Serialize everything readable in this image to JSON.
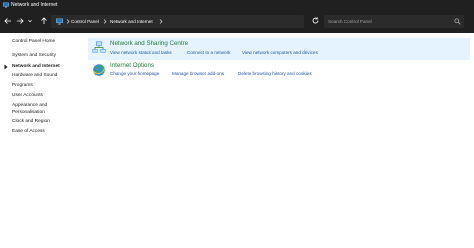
{
  "window": {
    "title": "Network and Internet"
  },
  "address_bar": {
    "breadcrumbs": [
      "Control Panel",
      "Network and Internet"
    ],
    "search_placeholder": "Search Control Panel"
  },
  "sidebar": {
    "items": [
      {
        "label": "Control Panel Home",
        "active": false
      },
      {
        "label": "System and Security",
        "active": false
      },
      {
        "label": "Network and Internet",
        "active": true
      },
      {
        "label": "Hardware and Sound",
        "active": false
      },
      {
        "label": "Programs",
        "active": false
      },
      {
        "label": "User Accounts",
        "active": false
      },
      {
        "label": "Appearance and Personalisation",
        "active": false
      },
      {
        "label": "Clock and Region",
        "active": false
      },
      {
        "label": "Ease of Access",
        "active": false
      }
    ]
  },
  "categories": [
    {
      "title": "Network and Sharing Centre",
      "icon": "network-sharing-icon",
      "links": [
        "View network status and tasks",
        "Connect to a network",
        "View network computers and devices"
      ]
    },
    {
      "title": "Internet Options",
      "icon": "internet-options-icon",
      "links": [
        "Change your homepage",
        "Manage browser add-ons",
        "Delete browsing history and cookies"
      ]
    }
  ],
  "colors": {
    "chrome_background": "#202020",
    "category_title": "#1e7d3a",
    "task_link": "#1a56a8",
    "selected_row": "#e5f3ff"
  }
}
